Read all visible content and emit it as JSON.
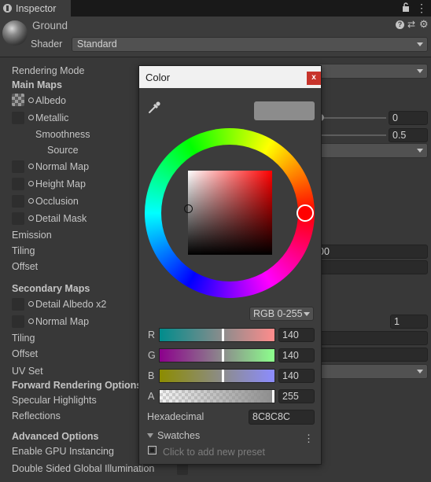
{
  "tab": {
    "label": "Inspector"
  },
  "material": {
    "name": "Ground",
    "shader_label": "Shader",
    "shader_value": "Standard"
  },
  "properties": {
    "rendering_mode": "Rendering Mode",
    "main_maps": "Main Maps",
    "albedo": "Albedo",
    "metallic": "Metallic",
    "smoothness": "Smoothness",
    "source": "Source",
    "normal_map": "Normal Map",
    "height_map": "Height Map",
    "occlusion": "Occlusion",
    "detail_mask": "Detail Mask",
    "emission": "Emission",
    "tiling": "Tiling",
    "offset": "Offset",
    "secondary_maps": "Secondary Maps",
    "detail_albedo": "Detail Albedo x2",
    "normal_map_2": "Normal Map",
    "tiling_2": "Tiling",
    "offset_2": "Offset",
    "uv_set": "UV Set",
    "forward_options": "Forward Rendering Options",
    "specular_highlights": "Specular Highlights",
    "reflections": "Reflections",
    "advanced_options": "Advanced Options",
    "gpu_instancing": "Enable GPU Instancing",
    "double_sided_gi": "Double Sided Global Illumination"
  },
  "values": {
    "metallic": "0",
    "smoothness": "0.5",
    "tiling_y": "00",
    "normal_scale": "1"
  },
  "color_picker": {
    "title": "Color",
    "close": "x",
    "mode": "RGB 0-255",
    "channels": [
      {
        "label": "R",
        "value": "140",
        "fraction": 0.549
      },
      {
        "label": "G",
        "value": "140",
        "fraction": 0.549
      },
      {
        "label": "B",
        "value": "140",
        "fraction": 0.549
      },
      {
        "label": "A",
        "value": "255",
        "fraction": 1.0
      }
    ],
    "hex_label": "Hexadecimal",
    "hex_value": "8C8C8C",
    "swatches_label": "Swatches",
    "preset_hint": "Click to add new preset",
    "current_color": "#8C8C8C"
  }
}
